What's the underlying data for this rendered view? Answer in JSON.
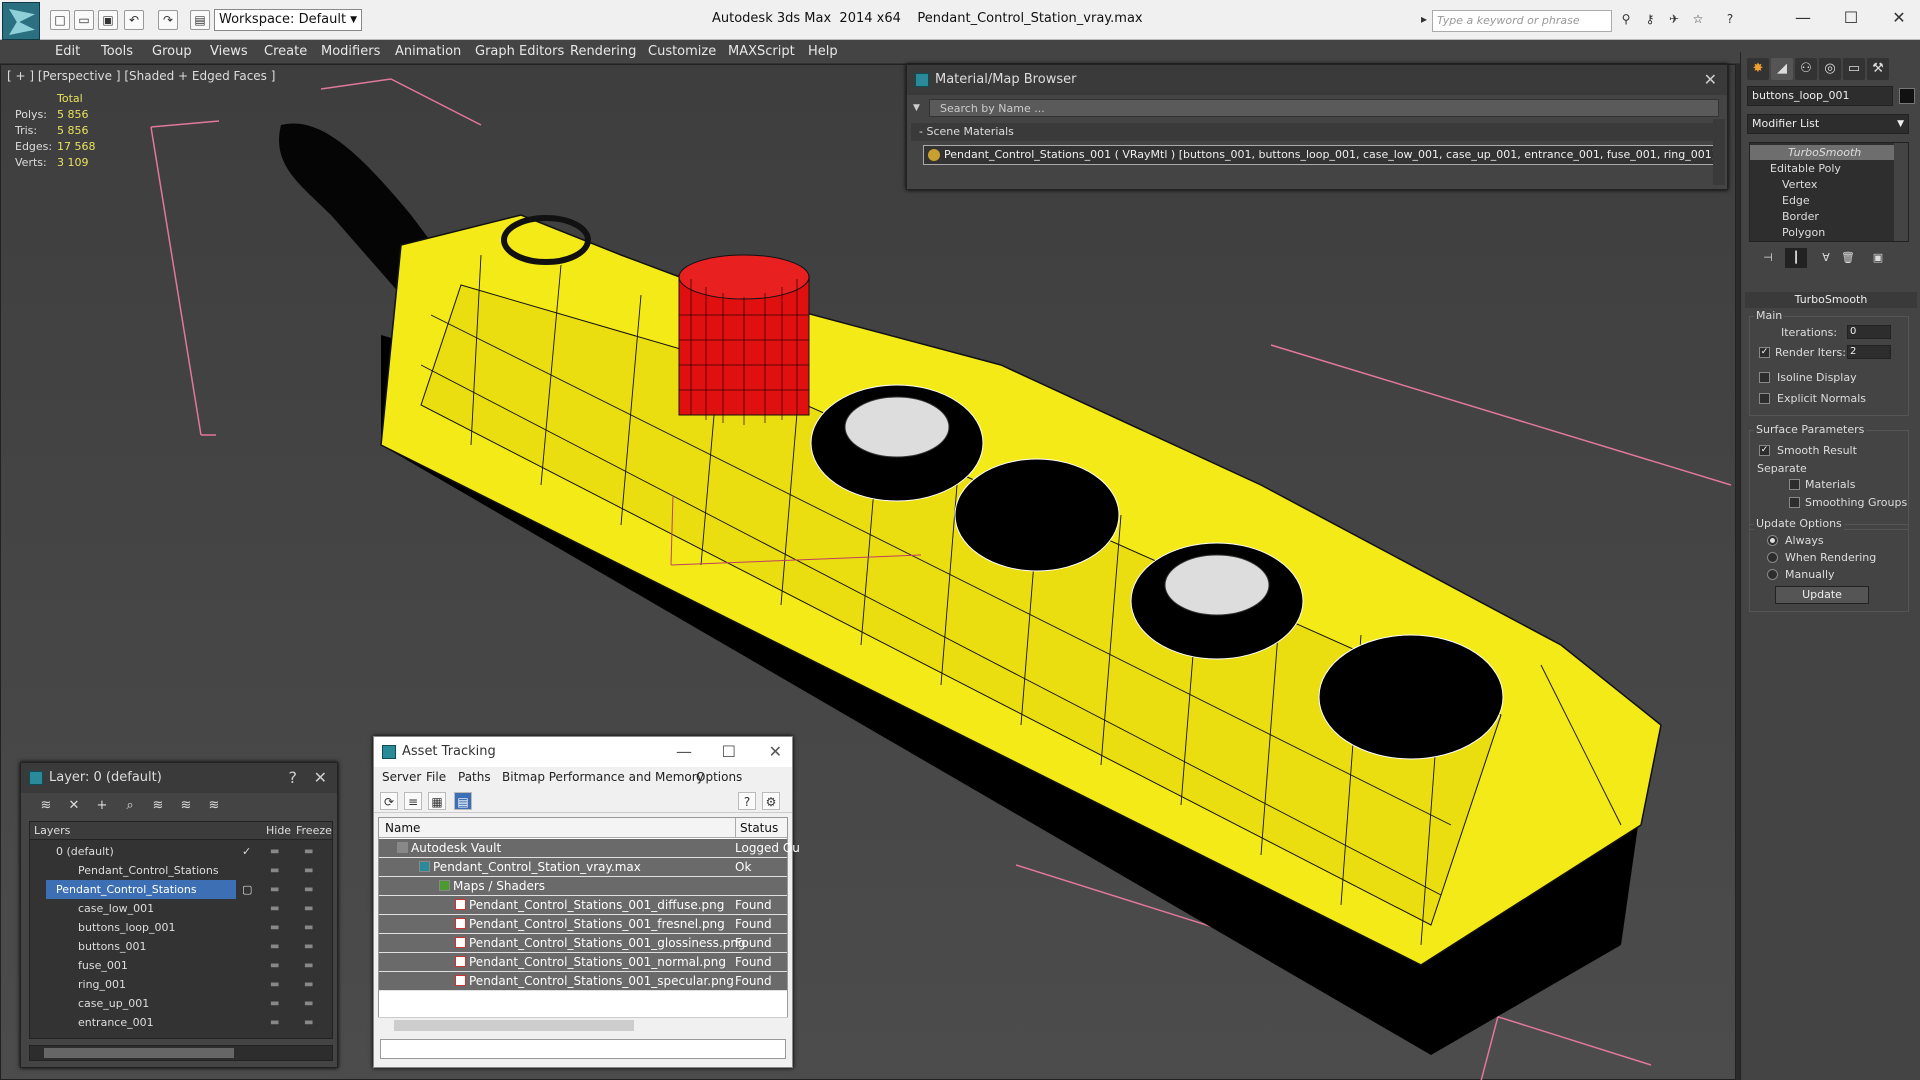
{
  "title_bar": {
    "workspace_label": "Workspace: Default",
    "app_title": "Autodesk 3ds Max  2014 x64",
    "file_title": "Pendant_Control_Station_vray.max",
    "search_placeholder": "Type a keyword or phrase"
  },
  "menu": [
    "Edit",
    "Tools",
    "Group",
    "Views",
    "Create",
    "Modifiers",
    "Animation",
    "Graph Editors",
    "Rendering",
    "Customize",
    "MAXScript",
    "Help"
  ],
  "viewport": {
    "label": "[ + ] [Perspective ] [Shaded + Edged Faces ]",
    "stats_header": "Total",
    "stats": [
      {
        "key": "Polys:",
        "value": "5 856"
      },
      {
        "key": "Tris:",
        "value": "5 856"
      },
      {
        "key": "Edges:",
        "value": "17 568"
      },
      {
        "key": "Verts:",
        "value": "3 109"
      }
    ]
  },
  "material_browser": {
    "title": "Material/Map Browser",
    "search_placeholder": "Search by Name ...",
    "section": "- Scene Materials",
    "material_row": "Pendant_Control_Stations_001  ( VRayMtl )  [buttons_001, buttons_loop_001, case_low_001, case_up_001, entrance_001, fuse_001, ring_001]"
  },
  "command_panel": {
    "object_name": "buttons_loop_001",
    "modifier_list": "Modifier List",
    "stack": [
      "TurboSmooth",
      "Editable Poly",
      "Vertex",
      "Edge",
      "Border",
      "Polygon"
    ],
    "rollout_title": "TurboSmooth",
    "main_group": "Main",
    "iterations_label": "Iterations:",
    "iterations_value": "0",
    "render_iters_label": "Render Iters:",
    "render_iters_value": "2",
    "isoline": "Isoline Display",
    "explicit_normals": "Explicit Normals",
    "surface_group": "Surface Parameters",
    "smooth_result": "Smooth Result",
    "separate": "Separate",
    "materials": "Materials",
    "smoothing_groups": "Smoothing Groups",
    "update_group": "Update Options",
    "always": "Always",
    "when_rendering": "When Rendering",
    "manually": "Manually",
    "update_button": "Update"
  },
  "layer_dialog": {
    "title": "Layer: 0 (default)",
    "col_layers": "Layers",
    "col_hide": "Hide",
    "col_freeze": "Freeze",
    "rows": [
      {
        "name": "0 (default)",
        "level": 0
      },
      {
        "name": "Pendant_Control_Stations",
        "level": 1
      },
      {
        "name": "Pendant_Control_Stations",
        "level": 0
      },
      {
        "name": "case_low_001",
        "level": 1
      },
      {
        "name": "buttons_loop_001",
        "level": 1
      },
      {
        "name": "buttons_001",
        "level": 1
      },
      {
        "name": "fuse_001",
        "level": 1
      },
      {
        "name": "ring_001",
        "level": 1
      },
      {
        "name": "case_up_001",
        "level": 1
      },
      {
        "name": "entrance_001",
        "level": 1
      }
    ]
  },
  "asset_tracking": {
    "title": "Asset Tracking",
    "menu": [
      "Server",
      "File",
      "Paths",
      "Bitmap Performance and Memory",
      "Options"
    ],
    "col_name": "Name",
    "col_status": "Status",
    "rows": [
      {
        "name": "Autodesk Vault",
        "status": "Logged Ou"
      },
      {
        "name": "Pendant_Control_Station_vray.max",
        "status": "Ok"
      },
      {
        "name": "Maps / Shaders",
        "status": ""
      },
      {
        "name": "Pendant_Control_Stations_001_diffuse.png",
        "status": "Found"
      },
      {
        "name": "Pendant_Control_Stations_001_fresnel.png",
        "status": "Found"
      },
      {
        "name": "Pendant_Control_Stations_001_glossiness.png",
        "status": "Found"
      },
      {
        "name": "Pendant_Control_Stations_001_normal.png",
        "status": "Found"
      },
      {
        "name": "Pendant_Control_Stations_001_specular.png",
        "status": "Found"
      }
    ]
  }
}
